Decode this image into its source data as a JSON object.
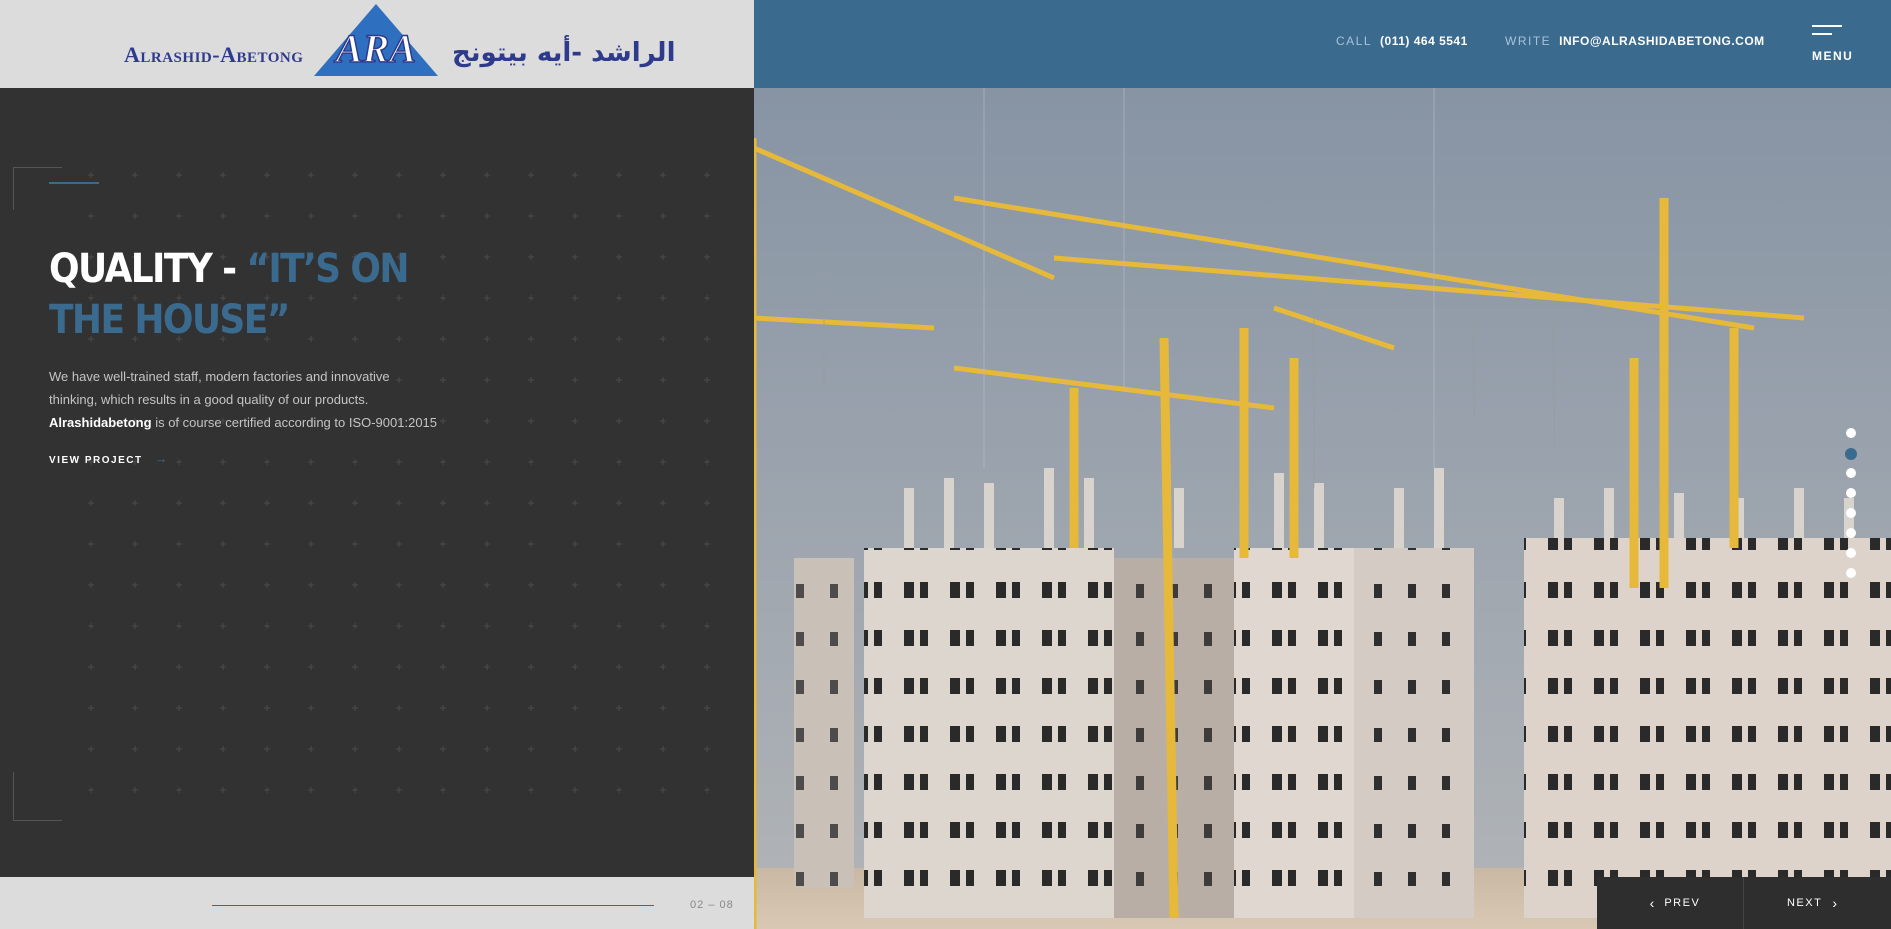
{
  "header": {
    "logo": {
      "latin": "Alrashid-Abetong",
      "mark": "ARA",
      "arabic": "الراشد -أيه بيتونج"
    },
    "call_label": "CALL",
    "call_value": "(011) 464 5541",
    "write_label": "WRITE",
    "write_value": "INFO@ALRASHIDABETONG.COM",
    "menu_label": "MENU"
  },
  "slide": {
    "title_white": "QUALITY - ",
    "title_blue": "“IT’S ON THE HOUSE”",
    "desc_line1": "We have well-trained staff, modern factories and innovative",
    "desc_line2": "thinking, which results in a good quality of our products.",
    "desc_brand": "Alrashidabetong",
    "desc_line3": " is of course certified according to ISO-9001:2015",
    "cta_label": "VIEW PROJECT",
    "cta_icon": "arrow-right-icon",
    "counter": "02 – 08",
    "current_index": 2,
    "total": 8
  },
  "pager": {
    "prev_label": "PREV",
    "next_label": "NEXT"
  },
  "colors": {
    "accent": "#3b6a8f",
    "header_left_bg": "#dcdcdc",
    "panel_bg": "#323232",
    "logo_blue": "#2e3a8c"
  }
}
